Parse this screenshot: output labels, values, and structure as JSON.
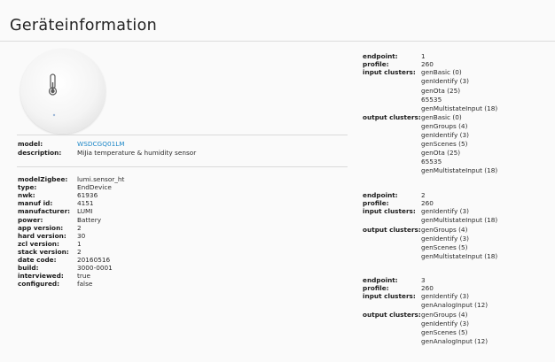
{
  "header": {
    "title": "Geräteinformation"
  },
  "device": {
    "image_icon": "temperature-humidity-sensor",
    "model_label": "model:",
    "model": "WSDCGQ01LM",
    "description_label": "description:",
    "description": "MiJia temperature & humidity sensor"
  },
  "details": [
    {
      "key": "modelZigbee:",
      "value": "lumi.sensor_ht"
    },
    {
      "key": "type:",
      "value": "EndDevice"
    },
    {
      "key": "nwk:",
      "value": "61936"
    },
    {
      "key": "manuf id:",
      "value": "4151"
    },
    {
      "key": "manufacturer:",
      "value": "LUMI"
    },
    {
      "key": "power:",
      "value": "Battery"
    },
    {
      "key": "app version:",
      "value": "2"
    },
    {
      "key": "hard version:",
      "value": "30"
    },
    {
      "key": "zcl version:",
      "value": "1"
    },
    {
      "key": "stack version:",
      "value": "2"
    },
    {
      "key": "date code:",
      "value": "20160516"
    },
    {
      "key": "build:",
      "value": "3000-0001"
    },
    {
      "key": "interviewed:",
      "value": "true"
    },
    {
      "key": "configured:",
      "value": "false"
    }
  ],
  "endpoints": [
    {
      "endpoint_label": "endpoint:",
      "endpoint": "1",
      "profile_label": "profile:",
      "profile": "260",
      "input_label": "input clusters:",
      "input_clusters": [
        "genBasic (0)",
        "genIdentify (3)",
        "genOta (25)",
        "65535",
        "genMultistateInput (18)"
      ],
      "output_label": "output clusters:",
      "output_clusters": [
        "genBasic (0)",
        "genGroups (4)",
        "genIdentify (3)",
        "genScenes (5)",
        "genOta (25)",
        "65535",
        "genMultistateInput (18)"
      ]
    },
    {
      "endpoint_label": "endpoint:",
      "endpoint": "2",
      "profile_label": "profile:",
      "profile": "260",
      "input_label": "input clusters:",
      "input_clusters": [
        "genIdentify (3)",
        "genMultistateInput (18)"
      ],
      "output_label": "output clusters:",
      "output_clusters": [
        "genGroups (4)",
        "genIdentify (3)",
        "genScenes (5)",
        "genMultistateInput (18)"
      ]
    },
    {
      "endpoint_label": "endpoint:",
      "endpoint": "3",
      "profile_label": "profile:",
      "profile": "260",
      "input_label": "input clusters:",
      "input_clusters": [
        "genIdentify (3)",
        "genAnalogInput (12)"
      ],
      "output_label": "output clusters:",
      "output_clusters": [
        "genGroups (4)",
        "genIdentify (3)",
        "genScenes (5)",
        "genAnalogInput (12)"
      ]
    }
  ]
}
